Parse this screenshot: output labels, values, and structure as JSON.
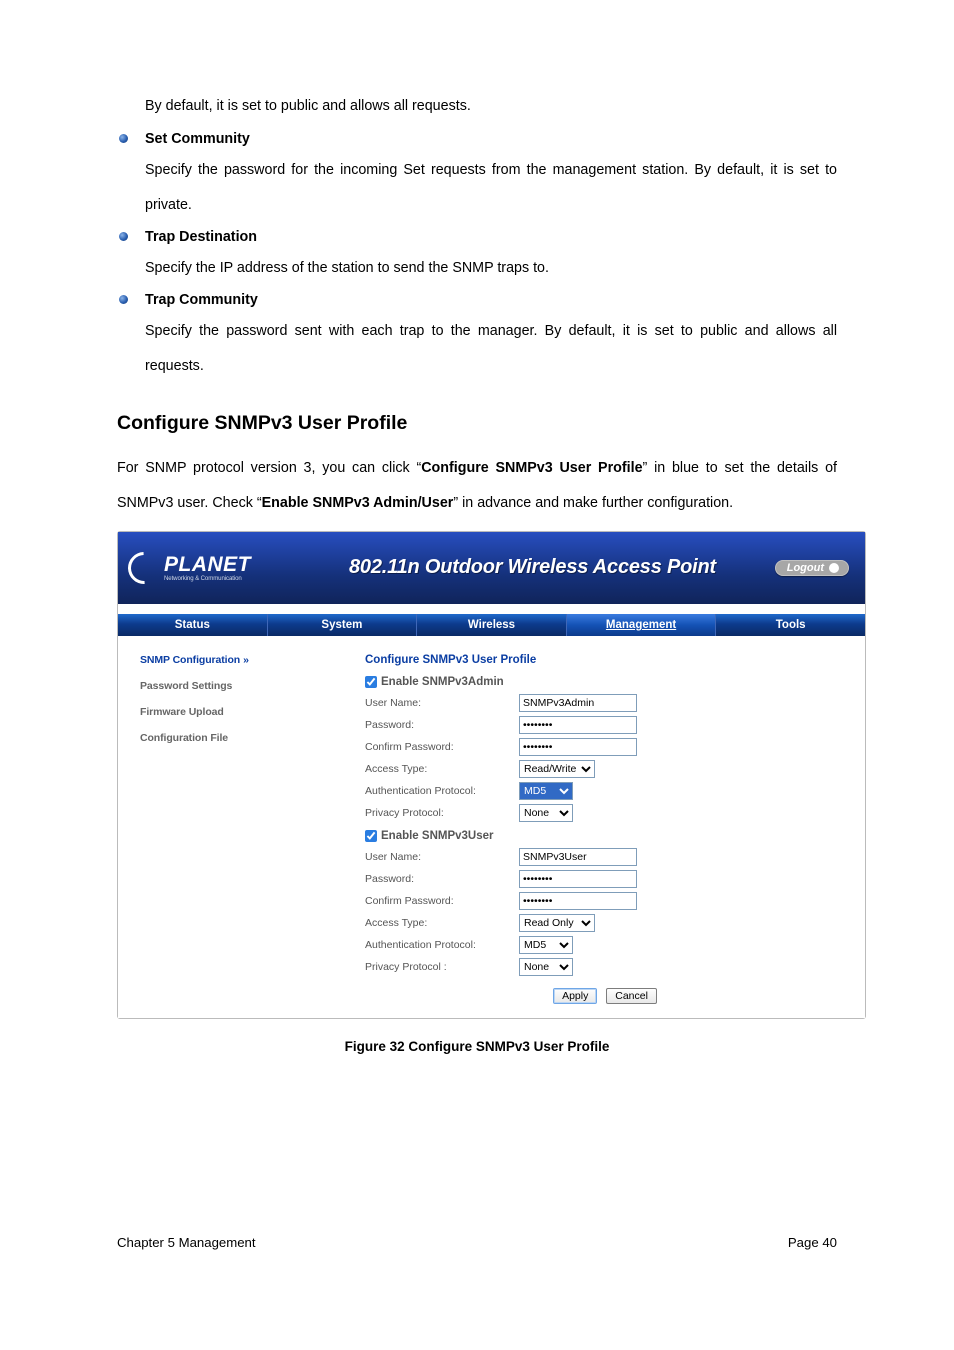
{
  "intro_text": "By default, it is set to public and allows all requests.",
  "bullets": [
    {
      "title": "Set Community",
      "desc": "Specify the password for the incoming Set requests from the management station. By default, it is set to private."
    },
    {
      "title": "Trap Destination",
      "desc": "Specify the IP address of the station to send the SNMP traps to."
    },
    {
      "title": "Trap Community",
      "desc": "Specify the password sent with each trap to the manager. By default, it is set to public and allows all requests."
    }
  ],
  "section_heading": "Configure SNMPv3 User Profile",
  "section_para_parts": {
    "p1": "For SNMP protocol version 3, you can click “",
    "b1": "Configure SNMPv3 User Profile",
    "p2": "” in blue to set the details of SNMPv3 user. Check “",
    "b2": "Enable SNMPv3 Admin/User",
    "p3": "” in advance and make further configuration."
  },
  "router": {
    "brand_main": "PLANET",
    "brand_sub": "Networking & Communication",
    "device_title": "802.11n Outdoor Wireless Access Point",
    "logout": "Logout",
    "tabs": [
      "Status",
      "System",
      "Wireless",
      "Management",
      "Tools"
    ],
    "active_tab": "Management",
    "side_menu": [
      {
        "label": "SNMP Configuration",
        "active": true,
        "arrows": "»"
      },
      {
        "label": "Password Settings",
        "active": false
      },
      {
        "label": "Firmware Upload",
        "active": false
      },
      {
        "label": "Configuration File",
        "active": false
      }
    ],
    "cfg_title": "Configure SNMPv3 User Profile",
    "admin": {
      "checkbox_label": "Enable SNMPv3Admin",
      "checked": true,
      "fields": {
        "username_label": "User Name:",
        "username_value": "SNMPv3Admin",
        "password_label": "Password:",
        "password_value": "••••••••",
        "confirm_label": "Confirm Password:",
        "confirm_value": "••••••••",
        "access_label": "Access Type:",
        "access_value": "Read/Write",
        "auth_label": "Authentication Protocol:",
        "auth_value": "MD5",
        "priv_label": "Privacy Protocol:",
        "priv_value": "None"
      }
    },
    "user": {
      "checkbox_label": "Enable SNMPv3User",
      "checked": true,
      "fields": {
        "username_label": "User Name:",
        "username_value": "SNMPv3User",
        "password_label": "Password:",
        "password_value": "••••••••",
        "confirm_label": "Confirm Password:",
        "confirm_value": "••••••••",
        "access_label": "Access Type:",
        "access_value": "Read Only",
        "auth_label": "Authentication Protocol:",
        "auth_value": "MD5",
        "priv_label": "Privacy Protocol :",
        "priv_value": "None"
      }
    },
    "buttons": {
      "apply": "Apply",
      "cancel": "Cancel"
    }
  },
  "figure_caption": "Figure 32 Configure SNMPv3 User Profile",
  "footer": {
    "left": "Chapter 5 Management",
    "right": "Page 40"
  }
}
